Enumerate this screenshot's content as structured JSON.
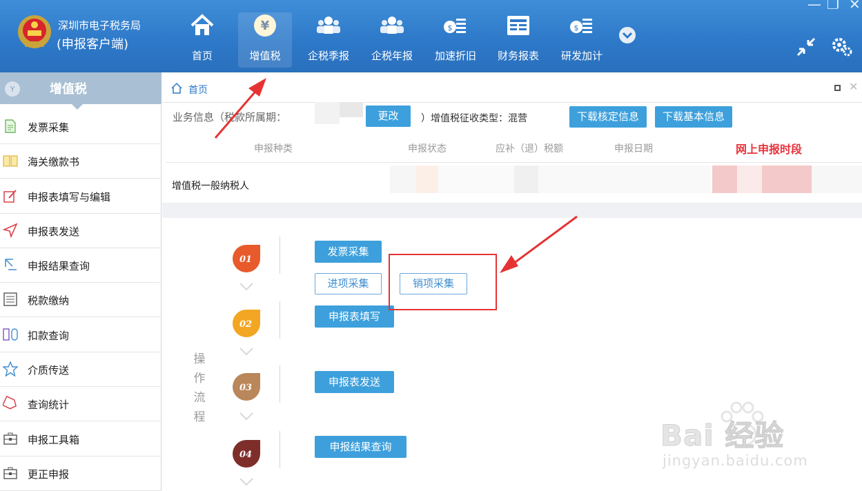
{
  "window": {
    "minimize": "—",
    "restore": "❐",
    "close": "✕"
  },
  "brand": {
    "line1": "深圳市电子税务局",
    "line2": "(申报客户端)"
  },
  "nav": [
    {
      "label": "首页",
      "icon": "home-icon"
    },
    {
      "label": "增值税",
      "icon": "yen-coin-icon",
      "active": true
    },
    {
      "label": "企税季报",
      "icon": "users-icon"
    },
    {
      "label": "企税年报",
      "icon": "users-icon"
    },
    {
      "label": "加速折旧",
      "icon": "money-stack-icon"
    },
    {
      "label": "财务报表",
      "icon": "report-icon"
    },
    {
      "label": "研发加计",
      "icon": "money-stack-icon"
    }
  ],
  "sidebar": {
    "title": "增值税",
    "items": [
      {
        "label": "发票采集",
        "icon": "document-icon"
      },
      {
        "label": "海关缴款书",
        "icon": "book-icon"
      },
      {
        "label": "申报表填写与编辑",
        "icon": "edit-icon"
      },
      {
        "label": "申报表发送",
        "icon": "send-icon"
      },
      {
        "label": "申报结果查询",
        "icon": "search-doc-icon"
      },
      {
        "label": "税款缴纳",
        "icon": "list-icon"
      },
      {
        "label": "扣款查询",
        "icon": "deduction-icon"
      },
      {
        "label": "介质传送",
        "icon": "star-icon"
      },
      {
        "label": "查询统计",
        "icon": "tag-icon"
      },
      {
        "label": "申报工具箱",
        "icon": "toolbox-icon"
      },
      {
        "label": "更正申报",
        "icon": "toolbox-icon"
      }
    ]
  },
  "breadcrumb": {
    "home": "首页",
    "close": "✕"
  },
  "info": {
    "label": "业务信息（税款所属期：",
    "change_button": "更改",
    "type_text": "）增值税征收类型：混营",
    "download_check": "下载核定信息",
    "download_basic": "下载基本信息"
  },
  "table": {
    "headers": [
      "申报种类",
      "申报状态",
      "应补（退）税额",
      "申报日期"
    ],
    "online_period": "网上申报时段",
    "row_label": "增值税一般纳税人"
  },
  "flow": {
    "label_chars": [
      "操",
      "作",
      "流",
      "程"
    ],
    "steps": [
      {
        "num": "01",
        "color": "#e85a2b",
        "buttons": [
          "发票采集"
        ]
      },
      {
        "num": "02",
        "color": "#f3a623",
        "buttons": [
          "申报表填写"
        ]
      },
      {
        "num": "03",
        "color": "#b9875a",
        "buttons": [
          "申报表发送"
        ]
      },
      {
        "num": "04",
        "color": "#7e2e2a",
        "buttons": [
          "申报结果查询"
        ]
      }
    ],
    "sub_buttons": [
      "进项采集",
      "销项采集"
    ]
  },
  "watermark": {
    "text": "Bai 经验",
    "url": "jingyan.baidu.com"
  },
  "colors": {
    "header": "#2d78c8",
    "accent": "#3da0dc",
    "highlight": "#e53333"
  }
}
